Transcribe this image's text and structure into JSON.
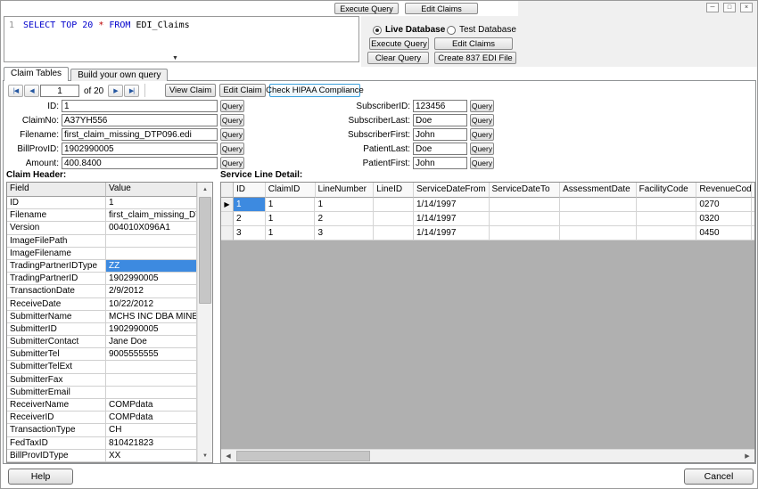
{
  "colors": {
    "selection_blue": "#3d8ae0",
    "nav_arrow_blue": "#2456a0",
    "hipaa_border": "#3aa0dc",
    "grid_background": "#b0b0b0"
  },
  "icons": {
    "up": "▲",
    "down": "▼",
    "left": "◀",
    "right": "▶",
    "row_pointer": "▶",
    "dropdown": "▼"
  },
  "sql": {
    "line_number": "1",
    "segments": [
      {
        "text": "SELECT TOP 20",
        "color": "#0000cc"
      },
      {
        "text": " * ",
        "color": "#bb0000"
      },
      {
        "text": "FROM",
        "color": "#0000cc"
      },
      {
        "text": " EDI_Claims",
        "color": "#000000"
      }
    ]
  },
  "top_buttons": {
    "execute": "Execute Query",
    "edit": "Edit Claims"
  },
  "window_controls": {
    "minimize": "─",
    "maximize": "□",
    "close": "×"
  },
  "db_panel": {
    "live_label": "Live Database",
    "test_label": "Test Database",
    "execute": "Execute Query",
    "edit": "Edit Claims",
    "clear": "Clear Query",
    "create": "Create 837 EDI File"
  },
  "tabs": [
    {
      "label": "Claim Tables"
    },
    {
      "label": "Build your own query"
    }
  ],
  "nav": {
    "first_icon": "|◀",
    "prev_icon": "◀",
    "position": "1",
    "count_label": "of 20",
    "next_icon": "▶",
    "last_icon": "▶|",
    "view": "View Claim",
    "edit": "Edit Claim",
    "hipaa": "Check HIPAA Compliance"
  },
  "form": {
    "query_button": "Query",
    "left": [
      {
        "label": "ID:",
        "value": "1"
      },
      {
        "label": "ClaimNo:",
        "value": "A37YH556"
      },
      {
        "label": "Filename:",
        "value": "first_claim_missing_DTP096.edi"
      },
      {
        "label": "BillProvID:",
        "value": "1902990005"
      },
      {
        "label": "Amount:",
        "value": "400.8400"
      }
    ],
    "right": [
      {
        "label": "SubscriberID:",
        "value": "123456"
      },
      {
        "label": "SubscriberLast:",
        "value": "Doe"
      },
      {
        "label": "SubscriberFirst:",
        "value": "John"
      },
      {
        "label": "PatientLast:",
        "value": "Doe"
      },
      {
        "label": "PatientFirst:",
        "value": "John"
      }
    ]
  },
  "claim_header": {
    "title": "Claim Header:",
    "columns": [
      "Field",
      "Value"
    ],
    "selected_index": 5,
    "rows": [
      [
        "ID",
        "1"
      ],
      [
        "Filename",
        "first_claim_missing_DT"
      ],
      [
        "Version",
        "004010X096A1"
      ],
      [
        "ImageFilePath",
        ""
      ],
      [
        "ImageFilename",
        ""
      ],
      [
        "TradingPartnerIDType",
        "ZZ"
      ],
      [
        "TradingPartnerID",
        "1902990005"
      ],
      [
        "TransactionDate",
        "2/9/2012"
      ],
      [
        "ReceiveDate",
        "10/22/2012"
      ],
      [
        "SubmitterName",
        "MCHS INC DBA MINER"
      ],
      [
        "SubmitterID",
        "1902990005"
      ],
      [
        "SubmitterContact",
        "Jane Doe"
      ],
      [
        "SubmitterTel",
        "9005555555"
      ],
      [
        "SubmitterTelExt",
        ""
      ],
      [
        "SubmitterFax",
        ""
      ],
      [
        "SubmitterEmail",
        ""
      ],
      [
        "ReceiverName",
        "COMPdata"
      ],
      [
        "ReceiverID",
        "COMPdata"
      ],
      [
        "TransactionType",
        "CH"
      ],
      [
        "FedTaxID",
        "810421823"
      ],
      [
        "BillProvIDType",
        "XX"
      ]
    ]
  },
  "service_lines": {
    "title": "Service Line Detail:",
    "columns": [
      "ID",
      "ClaimID",
      "LineNumber",
      "LineID",
      "ServiceDateFrom",
      "ServiceDateTo",
      "AssessmentDate",
      "FacilityCode",
      "RevenueCode"
    ],
    "selected_cell": {
      "row": 0,
      "col": 0
    },
    "rows": [
      [
        "1",
        "1",
        "1",
        "",
        "1/14/1997",
        "",
        "",
        "",
        "0270"
      ],
      [
        "2",
        "1",
        "2",
        "",
        "1/14/1997",
        "",
        "",
        "",
        "0320"
      ],
      [
        "3",
        "1",
        "3",
        "",
        "1/14/1997",
        "",
        "",
        "",
        "0450"
      ]
    ]
  },
  "footer": {
    "help": "Help",
    "cancel": "Cancel"
  }
}
